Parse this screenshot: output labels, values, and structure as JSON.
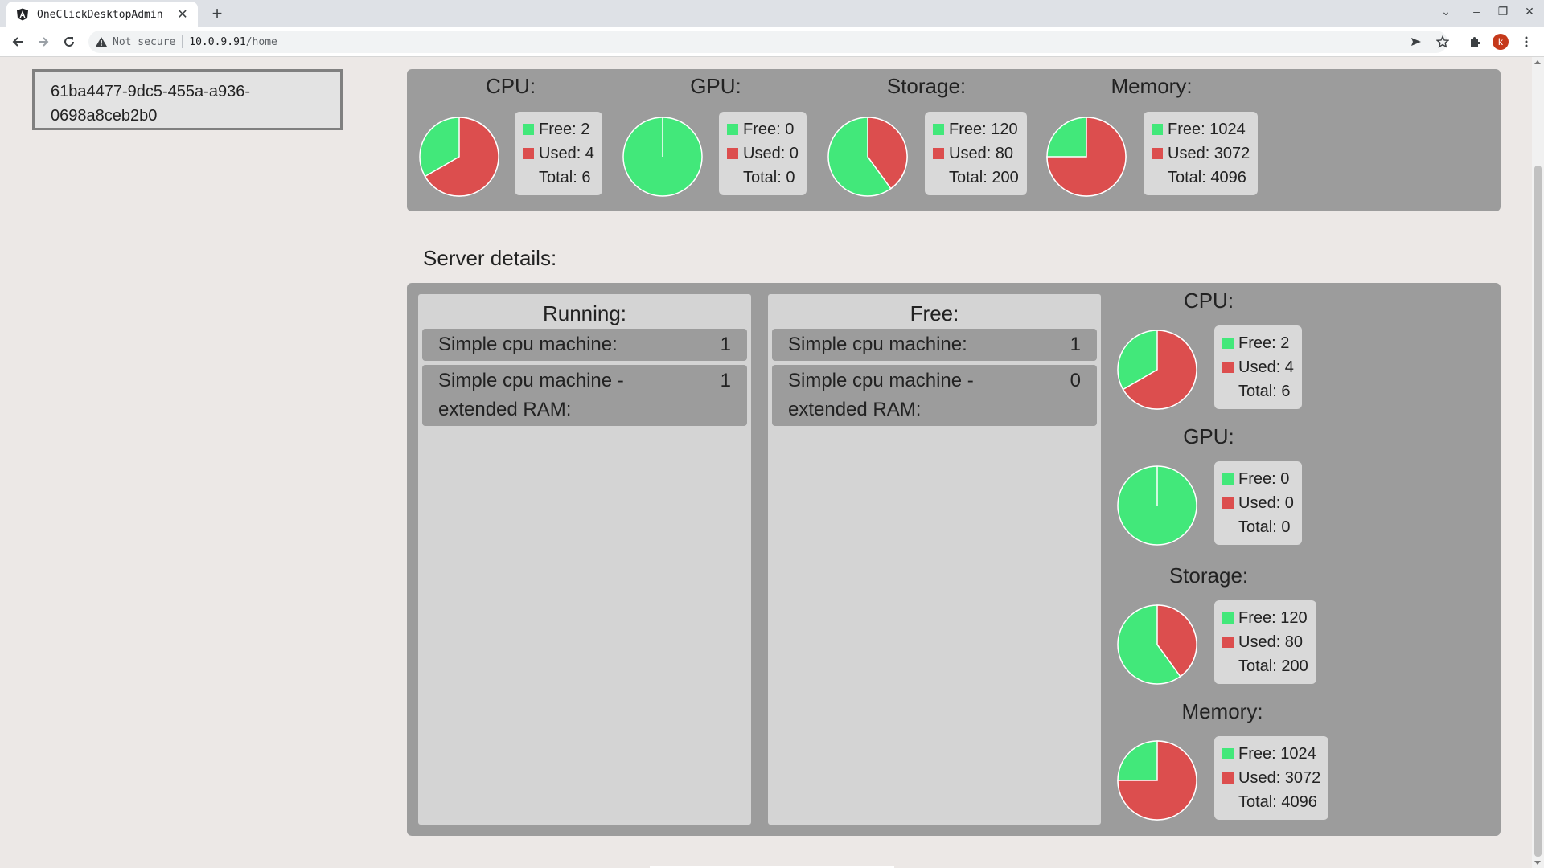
{
  "browser": {
    "tab_title": "OneClickDesktopAdmin",
    "not_secure_label": "Not secure",
    "url_host": "10.0.9.91",
    "url_path": "/home",
    "profile_initial": "k"
  },
  "colors": {
    "free": "#42e87a",
    "used": "#dc4e4e",
    "panel": "#9c9c9c"
  },
  "server_id": "61ba4477-9dc5-455a-a936-0698a8ceb2b0",
  "summary": {
    "resources": [
      {
        "title": "CPU:",
        "free": 2,
        "used": 4,
        "total": 6,
        "free_label": "Free: 2",
        "used_label": "Used: 4",
        "total_label": "Total: 6"
      },
      {
        "title": "GPU:",
        "free": 0,
        "used": 0,
        "total": 0,
        "free_label": "Free: 0",
        "used_label": "Used: 0",
        "total_label": "Total: 0"
      },
      {
        "title": "Storage:",
        "free": 120,
        "used": 80,
        "total": 200,
        "free_label": "Free: 120",
        "used_label": "Used: 80",
        "total_label": "Total: 200"
      },
      {
        "title": "Memory:",
        "free": 1024,
        "used": 3072,
        "total": 4096,
        "free_label": "Free: 1024",
        "used_label": "Used: 3072",
        "total_label": "Total: 4096"
      }
    ]
  },
  "details": {
    "title": "Server details:",
    "running": {
      "title": "Running:",
      "machines": [
        {
          "name": "Simple cpu machine:",
          "count": "1"
        },
        {
          "name": "Simple cpu machine - extended RAM:",
          "count": "1"
        }
      ]
    },
    "free": {
      "title": "Free:",
      "machines": [
        {
          "name": "Simple cpu machine:",
          "count": "1"
        },
        {
          "name": "Simple cpu machine - extended RAM:",
          "count": "0"
        }
      ]
    },
    "resources": [
      {
        "title": "CPU:",
        "free": 2,
        "used": 4,
        "total": 6,
        "free_label": "Free: 2",
        "used_label": "Used: 4",
        "total_label": "Total: 6"
      },
      {
        "title": "GPU:",
        "free": 0,
        "used": 0,
        "total": 0,
        "free_label": "Free: 0",
        "used_label": "Used: 0",
        "total_label": "Total: 0"
      },
      {
        "title": "Storage:",
        "free": 120,
        "used": 80,
        "total": 200,
        "free_label": "Free: 120",
        "used_label": "Used: 80",
        "total_label": "Total: 200"
      },
      {
        "title": "Memory:",
        "free": 1024,
        "used": 3072,
        "total": 4096,
        "free_label": "Free: 1024",
        "used_label": "Used: 3072",
        "total_label": "Total: 4096"
      }
    ]
  }
}
